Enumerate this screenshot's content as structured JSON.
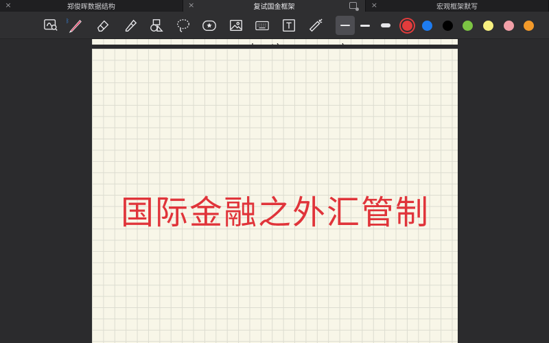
{
  "tabs": [
    {
      "label": "郑俊晖数据结构",
      "active": false
    },
    {
      "label": "复试国金框架",
      "active": true
    },
    {
      "label": "宏观框架默写",
      "active": false
    }
  ],
  "toolbar": {
    "tools": [
      "lasso-view-icon",
      "pen-icon",
      "eraser-icon",
      "highlighter-icon",
      "shapes-icon",
      "lasso-icon",
      "sticker-icon",
      "image-icon",
      "keyboard-icon",
      "text-box-icon",
      "laser-pointer-icon"
    ],
    "strokes": [
      "thin",
      "medium",
      "thick"
    ],
    "colors": [
      "#e23c3c",
      "#1e7cf0",
      "#000000",
      "#7cc443",
      "#f7f080",
      "#f2a0a8",
      "#f39a2a"
    ]
  },
  "canvas": {
    "title": "国际金融之外汇管制",
    "title_color": "#e0343a"
  }
}
